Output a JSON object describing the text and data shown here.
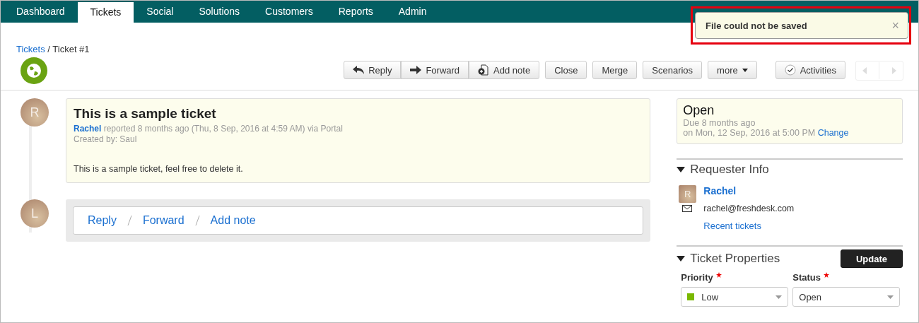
{
  "nav": {
    "tabs": [
      {
        "label": "Dashboard",
        "selected": false
      },
      {
        "label": "Tickets",
        "selected": true
      },
      {
        "label": "Social",
        "selected": false
      },
      {
        "label": "Solutions",
        "selected": false
      },
      {
        "label": "Customers",
        "selected": false
      },
      {
        "label": "Reports",
        "selected": false
      },
      {
        "label": "Admin",
        "selected": false
      }
    ]
  },
  "toast": {
    "message": "File could not be saved",
    "close": "×"
  },
  "breadcrumb": {
    "link": "Tickets",
    "current": " / Ticket #1"
  },
  "toolbar": {
    "group": [
      {
        "label": "Reply",
        "kind": "reply"
      },
      {
        "label": "Forward",
        "kind": "forward"
      },
      {
        "label": "Add note",
        "kind": "note"
      }
    ],
    "buttons": [
      {
        "label": "Close",
        "caret": false
      },
      {
        "label": "Merge",
        "caret": false
      },
      {
        "label": "Scenarios",
        "caret": false
      },
      {
        "label": "more",
        "caret": true
      }
    ],
    "activities": "Activities"
  },
  "ticket": {
    "avatar": "R",
    "title": "This is a sample ticket",
    "author": "Rachel",
    "meta": "reported 8 months ago (Thu, 8 Sep, 2016 at 4:59 AM) via Portal",
    "created": "Created by: Saul",
    "body": "This is a sample ticket, feel free to delete it."
  },
  "reply_box": {
    "avatar": "L",
    "links": [
      "Reply",
      "Forward",
      "Add note"
    ]
  },
  "status_card": {
    "status": "Open",
    "due": "Due 8 months ago",
    "due_date": "on Mon, 12 Sep, 2016 at 5:00 PM",
    "change": "Change"
  },
  "requester": {
    "heading": "Requester Info",
    "expanded": true,
    "avatar": "R",
    "name": "Rachel",
    "email": "rachel@freshdesk.com",
    "recent": "Recent tickets"
  },
  "properties": {
    "heading": "Ticket Properties",
    "expanded": true,
    "update": "Update",
    "fields": [
      {
        "label": "Priority",
        "required": true,
        "value": "Low",
        "color": "#7ab800"
      },
      {
        "label": "Status",
        "required": true,
        "value": "Open"
      }
    ]
  }
}
